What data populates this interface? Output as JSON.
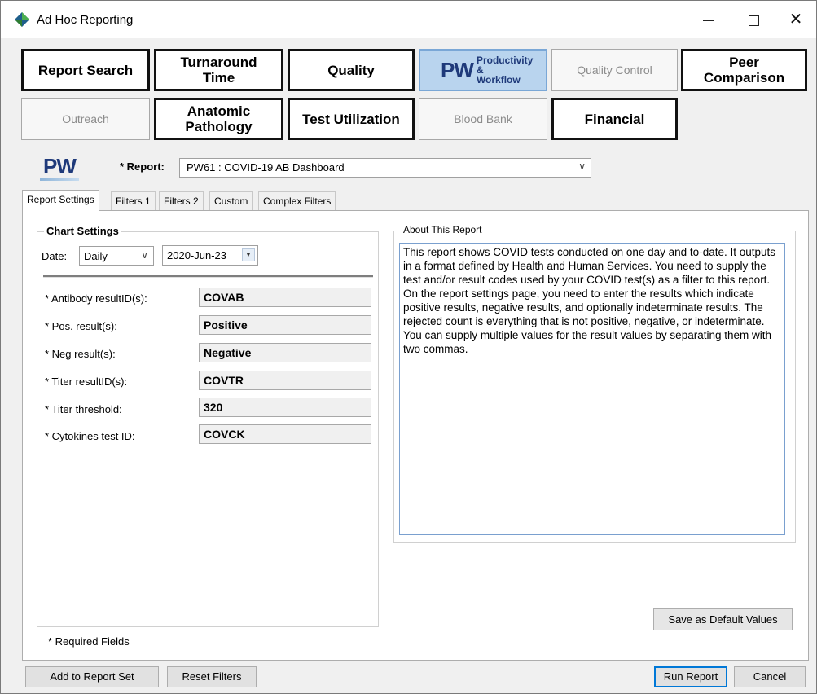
{
  "window": {
    "title": "Ad Hoc Reporting",
    "controls": {
      "minimize": "–",
      "close": "✕"
    }
  },
  "modules": {
    "report_search": "Report Search",
    "turnaround_time": "Turnaround Time",
    "quality": "Quality",
    "productivity_logo": "PW",
    "productivity": "Productivity & Workflow",
    "quality_control": "Quality Control",
    "peer_comparison": "Peer Comparison",
    "outreach": "Outreach",
    "anatomic_pathology": "Anatomic Pathology",
    "test_utilization": "Test Utilization",
    "blood_bank": "Blood Bank",
    "financial": "Financial"
  },
  "report": {
    "logo": "PW",
    "label": "* Report:",
    "selected": "PW61 : COVID-19 AB Dashboard"
  },
  "tabs": [
    "Report Settings",
    "Filters 1",
    "Filters 2",
    "Custom",
    "Complex Filters"
  ],
  "chart_settings": {
    "title": "Chart Settings",
    "date_label": "Date:",
    "date_period": "Daily",
    "date_value": "2020-Jun-23",
    "fields": [
      {
        "label": "* Antibody resultID(s):",
        "value": "COVAB"
      },
      {
        "label": "* Pos. result(s):",
        "value": "Positive"
      },
      {
        "label": "* Neg result(s):",
        "value": "Negative"
      },
      {
        "label": "* Titer resultID(s):",
        "value": "COVTR"
      },
      {
        "label": "* Titer threshold:",
        "value": "320"
      },
      {
        "label": "* Cytokines test ID:",
        "value": "COVCK"
      }
    ]
  },
  "about": {
    "title": "About This Report",
    "text": "This report shows COVID tests conducted on one day and to-date. It outputs in a format defined by Health and Human Services. You need to supply the test and/or result codes used by your COVID test(s) as a filter to this report. On the report settings page, you need to enter the results which indicate positive results, negative results, and optionally indeterminate results. The rejected count is everything that is not positive, negative, or indeterminate. You can supply multiple values for the result values by separating them with two commas."
  },
  "save_default": "Save as Default Values",
  "required_note": "* Required Fields",
  "footer": {
    "add_to_set": "Add to Report Set",
    "reset_filters": "Reset Filters",
    "run_report": "Run Report",
    "cancel": "Cancel"
  },
  "colors": {
    "active_module_bg": "#b9d4ee",
    "brand_blue": "#1f3a7a",
    "focus_border": "#0078d7"
  }
}
